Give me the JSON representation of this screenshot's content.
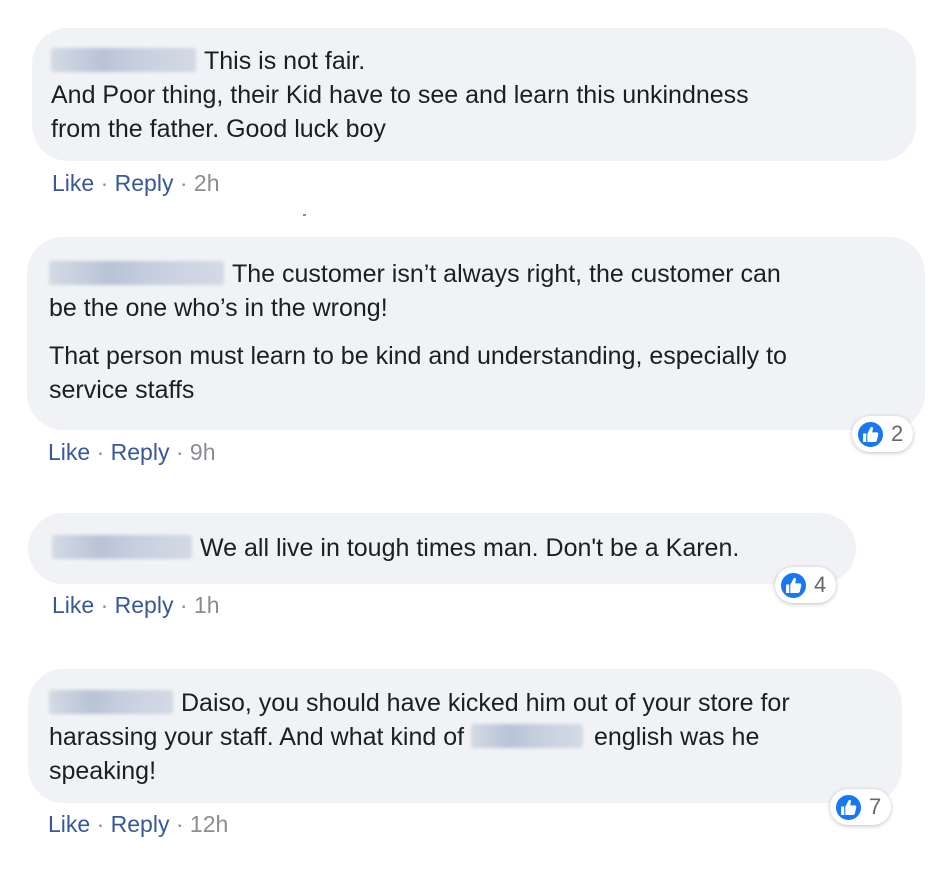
{
  "comments": [
    {
      "lines": [
        "This is not fair.",
        "And Poor thing, their Kid have to see and learn this unkindness",
        "from the father. Good luck boy"
      ],
      "actions": {
        "like": "Like",
        "reply": "Reply",
        "time": "2h",
        "sep": "·"
      }
    },
    {
      "para1": [
        "The customer isn’t always right, the customer can",
        "be the one who’s in the wrong!"
      ],
      "para2": [
        "That person must learn to be kind and understanding, especially to",
        "service staffs"
      ],
      "reaction_count": "2",
      "actions": {
        "like": "Like",
        "reply": "Reply",
        "time": "9h",
        "sep": "·"
      }
    },
    {
      "lines": [
        "We all live in tough times man. Don't be a Karen."
      ],
      "reaction_count": "4",
      "actions": {
        "like": "Like",
        "reply": "Reply",
        "time": "1h",
        "sep": "·"
      }
    },
    {
      "line1": "Daiso, you should have kicked him out of your store for",
      "line2_before": "harassing your staff. And what kind of",
      "line2_after": "english was he",
      "line3": "speaking!",
      "reaction_count": "7",
      "actions": {
        "like": "Like",
        "reply": "Reply",
        "time": "12h",
        "sep": "·"
      }
    }
  ],
  "icons": {
    "reaction": "like-thumbs-up-icon",
    "blurred": "blurred-text"
  },
  "colors": {
    "bubble": "#f0f2f5",
    "link": "#385898",
    "muted": "#8a8d91",
    "like_blue": "#1877f2"
  }
}
